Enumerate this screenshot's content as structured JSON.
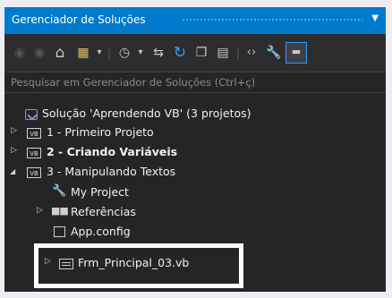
{
  "window": {
    "title": "Gerenciador de Soluções",
    "dropdown_glyph": "▼"
  },
  "toolbar": {
    "items": [
      {
        "icon": "back-circle-icon",
        "glyph": "◉"
      },
      {
        "icon": "forward-circle-icon",
        "glyph": "◉"
      },
      {
        "icon": "home-icon",
        "glyph": "⌂"
      },
      {
        "icon": "switch-views-icon",
        "glyph": "▦"
      },
      {
        "icon": "dropdown-arrow-icon",
        "glyph": "▾"
      },
      {
        "icon": "pending-changes-icon",
        "glyph": "◷"
      },
      {
        "icon": "dropdown-arrow-icon",
        "glyph": "▾"
      },
      {
        "icon": "sync-icon",
        "glyph": "⇆"
      },
      {
        "icon": "refresh-icon",
        "glyph": "↻"
      },
      {
        "icon": "collapse-all-icon",
        "glyph": "❐"
      },
      {
        "icon": "show-all-files-icon",
        "glyph": "▤"
      },
      {
        "icon": "view-code-icon",
        "glyph": "‹›"
      },
      {
        "icon": "properties-icon",
        "glyph": "🔧"
      },
      {
        "icon": "pin-icon",
        "glyph": "▬"
      }
    ]
  },
  "search": {
    "placeholder": "Pesquisar em Gerenciador de Soluções (Ctrl+ç)"
  },
  "tree": {
    "solution": {
      "label": "Solução 'Aprendendo VB' (3 projetos)"
    },
    "project1": {
      "label": "1 - Primeiro Projeto",
      "icon_text": "VB",
      "arrow": "▷"
    },
    "project2": {
      "label": "2 - Criando Variáveis",
      "icon_text": "VB",
      "arrow": "▷"
    },
    "project3": {
      "label": "3 - Manipulando Textos",
      "icon_text": "VB",
      "arrow": "◢"
    },
    "my_project": {
      "label": "My Project"
    },
    "references": {
      "label": "Referências",
      "arrow": "▷",
      "icon_text": "■■"
    },
    "app_config": {
      "label": "App.config"
    },
    "form_file": {
      "label": "Frm_Principal_03.vb",
      "arrow": "▷"
    }
  },
  "colors": {
    "accent": "#007acc",
    "panel": "#252526",
    "highlight": "#ffffff"
  }
}
